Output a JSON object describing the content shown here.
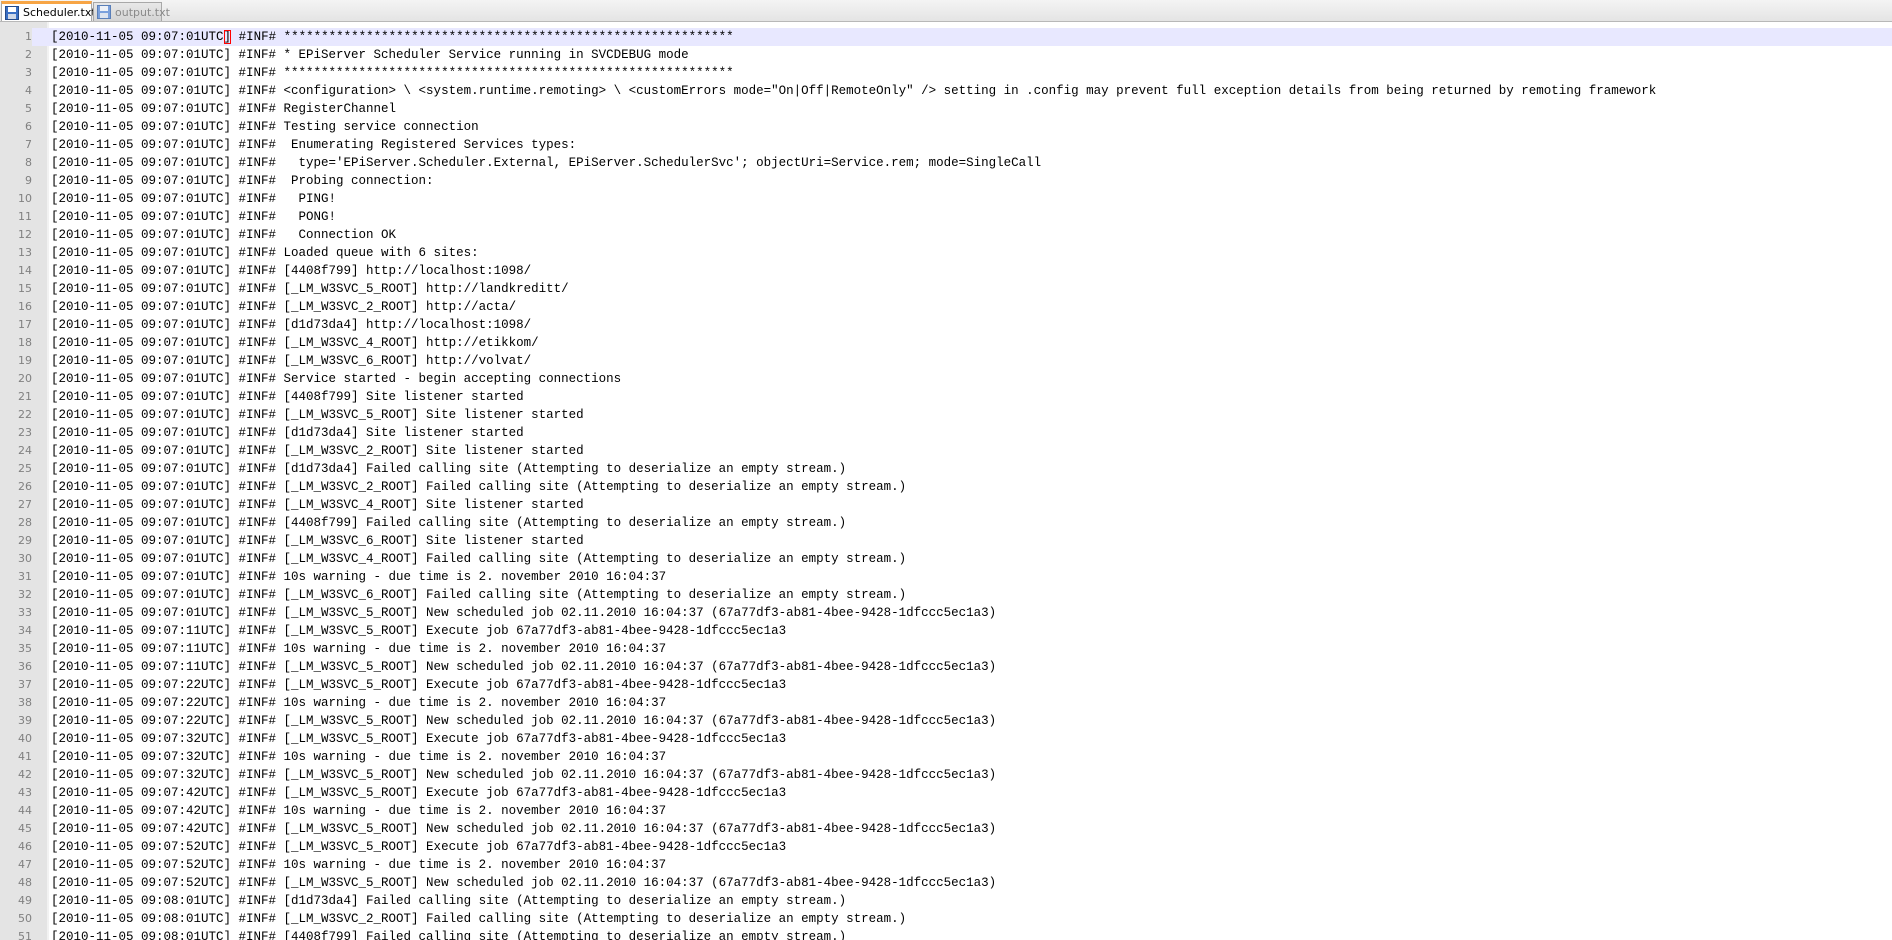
{
  "tabs": [
    {
      "label": "Scheduler.txt",
      "active": true,
      "icon": "floppy-save-icon"
    },
    {
      "label": "output.txt",
      "active": false,
      "icon": "floppy-save-icon"
    }
  ],
  "colors": {
    "active_tab_accent": "#f7a545",
    "gutter": "#e4e4e4",
    "current_line": "#e8e8ff",
    "bracket_match": "#ff0000"
  },
  "editor": {
    "current_line": 1,
    "lines": [
      {
        "n": "1",
        "text": "[2010-11-05 09:07:01UTC] #INF# ************************************************************"
      },
      {
        "n": "2",
        "text": "[2010-11-05 09:07:01UTC] #INF# * EPiServer Scheduler Service running in SVCDEBUG mode"
      },
      {
        "n": "3",
        "text": "[2010-11-05 09:07:01UTC] #INF# ************************************************************"
      },
      {
        "n": "4",
        "text": "[2010-11-05 09:07:01UTC] #INF# <configuration> \\ <system.runtime.remoting> \\ <customErrors mode=\"On|Off|RemoteOnly\" /> setting in .config may prevent full exception details from being returned by remoting framework"
      },
      {
        "n": "5",
        "text": "[2010-11-05 09:07:01UTC] #INF# RegisterChannel"
      },
      {
        "n": "6",
        "text": "[2010-11-05 09:07:01UTC] #INF# Testing service connection"
      },
      {
        "n": "7",
        "text": "[2010-11-05 09:07:01UTC] #INF#  Enumerating Registered Services types:"
      },
      {
        "n": "8",
        "text": "[2010-11-05 09:07:01UTC] #INF#   type='EPiServer.Scheduler.External, EPiServer.SchedulerSvc'; objectUri=Service.rem; mode=SingleCall"
      },
      {
        "n": "9",
        "text": "[2010-11-05 09:07:01UTC] #INF#  Probing connection:"
      },
      {
        "n": "10",
        "text": "[2010-11-05 09:07:01UTC] #INF#   PING!"
      },
      {
        "n": "11",
        "text": "[2010-11-05 09:07:01UTC] #INF#   PONG!"
      },
      {
        "n": "12",
        "text": "[2010-11-05 09:07:01UTC] #INF#   Connection OK"
      },
      {
        "n": "13",
        "text": "[2010-11-05 09:07:01UTC] #INF# Loaded queue with 6 sites:"
      },
      {
        "n": "14",
        "text": "[2010-11-05 09:07:01UTC] #INF# [4408f799] http://localhost:1098/"
      },
      {
        "n": "15",
        "text": "[2010-11-05 09:07:01UTC] #INF# [_LM_W3SVC_5_ROOT] http://landkreditt/"
      },
      {
        "n": "16",
        "text": "[2010-11-05 09:07:01UTC] #INF# [_LM_W3SVC_2_ROOT] http://acta/"
      },
      {
        "n": "17",
        "text": "[2010-11-05 09:07:01UTC] #INF# [d1d73da4] http://localhost:1098/"
      },
      {
        "n": "18",
        "text": "[2010-11-05 09:07:01UTC] #INF# [_LM_W3SVC_4_ROOT] http://etikkom/"
      },
      {
        "n": "19",
        "text": "[2010-11-05 09:07:01UTC] #INF# [_LM_W3SVC_6_ROOT] http://volvat/"
      },
      {
        "n": "20",
        "text": "[2010-11-05 09:07:01UTC] #INF# Service started - begin accepting connections"
      },
      {
        "n": "21",
        "text": "[2010-11-05 09:07:01UTC] #INF# [4408f799] Site listener started"
      },
      {
        "n": "22",
        "text": "[2010-11-05 09:07:01UTC] #INF# [_LM_W3SVC_5_ROOT] Site listener started"
      },
      {
        "n": "23",
        "text": "[2010-11-05 09:07:01UTC] #INF# [d1d73da4] Site listener started"
      },
      {
        "n": "24",
        "text": "[2010-11-05 09:07:01UTC] #INF# [_LM_W3SVC_2_ROOT] Site listener started"
      },
      {
        "n": "25",
        "text": "[2010-11-05 09:07:01UTC] #INF# [d1d73da4] Failed calling site (Attempting to deserialize an empty stream.)"
      },
      {
        "n": "26",
        "text": "[2010-11-05 09:07:01UTC] #INF# [_LM_W3SVC_2_ROOT] Failed calling site (Attempting to deserialize an empty stream.)"
      },
      {
        "n": "27",
        "text": "[2010-11-05 09:07:01UTC] #INF# [_LM_W3SVC_4_ROOT] Site listener started"
      },
      {
        "n": "28",
        "text": "[2010-11-05 09:07:01UTC] #INF# [4408f799] Failed calling site (Attempting to deserialize an empty stream.)"
      },
      {
        "n": "29",
        "text": "[2010-11-05 09:07:01UTC] #INF# [_LM_W3SVC_6_ROOT] Site listener started"
      },
      {
        "n": "30",
        "text": "[2010-11-05 09:07:01UTC] #INF# [_LM_W3SVC_4_ROOT] Failed calling site (Attempting to deserialize an empty stream.)"
      },
      {
        "n": "31",
        "text": "[2010-11-05 09:07:01UTC] #INF# 10s warning - due time is 2. november 2010 16:04:37"
      },
      {
        "n": "32",
        "text": "[2010-11-05 09:07:01UTC] #INF# [_LM_W3SVC_6_ROOT] Failed calling site (Attempting to deserialize an empty stream.)"
      },
      {
        "n": "33",
        "text": "[2010-11-05 09:07:01UTC] #INF# [_LM_W3SVC_5_ROOT] New scheduled job 02.11.2010 16:04:37 (67a77df3-ab81-4bee-9428-1dfccc5ec1a3)"
      },
      {
        "n": "34",
        "text": "[2010-11-05 09:07:11UTC] #INF# [_LM_W3SVC_5_ROOT] Execute job 67a77df3-ab81-4bee-9428-1dfccc5ec1a3"
      },
      {
        "n": "35",
        "text": "[2010-11-05 09:07:11UTC] #INF# 10s warning - due time is 2. november 2010 16:04:37"
      },
      {
        "n": "36",
        "text": "[2010-11-05 09:07:11UTC] #INF# [_LM_W3SVC_5_ROOT] New scheduled job 02.11.2010 16:04:37 (67a77df3-ab81-4bee-9428-1dfccc5ec1a3)"
      },
      {
        "n": "37",
        "text": "[2010-11-05 09:07:22UTC] #INF# [_LM_W3SVC_5_ROOT] Execute job 67a77df3-ab81-4bee-9428-1dfccc5ec1a3"
      },
      {
        "n": "38",
        "text": "[2010-11-05 09:07:22UTC] #INF# 10s warning - due time is 2. november 2010 16:04:37"
      },
      {
        "n": "39",
        "text": "[2010-11-05 09:07:22UTC] #INF# [_LM_W3SVC_5_ROOT] New scheduled job 02.11.2010 16:04:37 (67a77df3-ab81-4bee-9428-1dfccc5ec1a3)"
      },
      {
        "n": "40",
        "text": "[2010-11-05 09:07:32UTC] #INF# [_LM_W3SVC_5_ROOT] Execute job 67a77df3-ab81-4bee-9428-1dfccc5ec1a3"
      },
      {
        "n": "41",
        "text": "[2010-11-05 09:07:32UTC] #INF# 10s warning - due time is 2. november 2010 16:04:37"
      },
      {
        "n": "42",
        "text": "[2010-11-05 09:07:32UTC] #INF# [_LM_W3SVC_5_ROOT] New scheduled job 02.11.2010 16:04:37 (67a77df3-ab81-4bee-9428-1dfccc5ec1a3)"
      },
      {
        "n": "43",
        "text": "[2010-11-05 09:07:42UTC] #INF# [_LM_W3SVC_5_ROOT] Execute job 67a77df3-ab81-4bee-9428-1dfccc5ec1a3"
      },
      {
        "n": "44",
        "text": "[2010-11-05 09:07:42UTC] #INF# 10s warning - due time is 2. november 2010 16:04:37"
      },
      {
        "n": "45",
        "text": "[2010-11-05 09:07:42UTC] #INF# [_LM_W3SVC_5_ROOT] New scheduled job 02.11.2010 16:04:37 (67a77df3-ab81-4bee-9428-1dfccc5ec1a3)"
      },
      {
        "n": "46",
        "text": "[2010-11-05 09:07:52UTC] #INF# [_LM_W3SVC_5_ROOT] Execute job 67a77df3-ab81-4bee-9428-1dfccc5ec1a3"
      },
      {
        "n": "47",
        "text": "[2010-11-05 09:07:52UTC] #INF# 10s warning - due time is 2. november 2010 16:04:37"
      },
      {
        "n": "48",
        "text": "[2010-11-05 09:07:52UTC] #INF# [_LM_W3SVC_5_ROOT] New scheduled job 02.11.2010 16:04:37 (67a77df3-ab81-4bee-9428-1dfccc5ec1a3)"
      },
      {
        "n": "49",
        "text": "[2010-11-05 09:08:01UTC] #INF# [d1d73da4] Failed calling site (Attempting to deserialize an empty stream.)"
      },
      {
        "n": "50",
        "text": "[2010-11-05 09:08:01UTC] #INF# [_LM_W3SVC_2_ROOT] Failed calling site (Attempting to deserialize an empty stream.)"
      },
      {
        "n": "51",
        "text": "[2010-11-05 09:08:01UTC] #INF# [4408f799] Failed calling site (Attempting to deserialize an empty stream.)"
      }
    ]
  }
}
